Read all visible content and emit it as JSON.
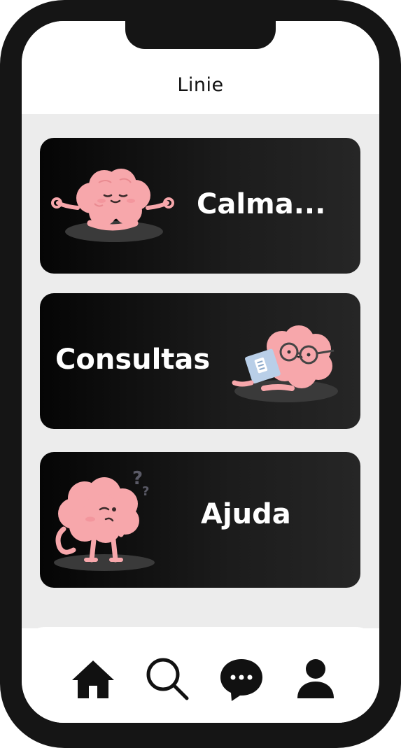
{
  "header": {
    "title": "Linie"
  },
  "cards": [
    {
      "label": "Calma...",
      "art": "meditating-brain-icon"
    },
    {
      "label": "Consultas",
      "art": "reading-brain-icon"
    },
    {
      "label": "Ajuda",
      "art": "confused-brain-icon"
    }
  ],
  "nav": {
    "items": [
      "home-icon",
      "search-icon",
      "chat-icon",
      "profile-icon"
    ]
  },
  "colors": {
    "frame": "#151515",
    "background": "#ececec",
    "card": "#111111",
    "brain": "#f7a7ab",
    "card_text": "#ffffff"
  }
}
